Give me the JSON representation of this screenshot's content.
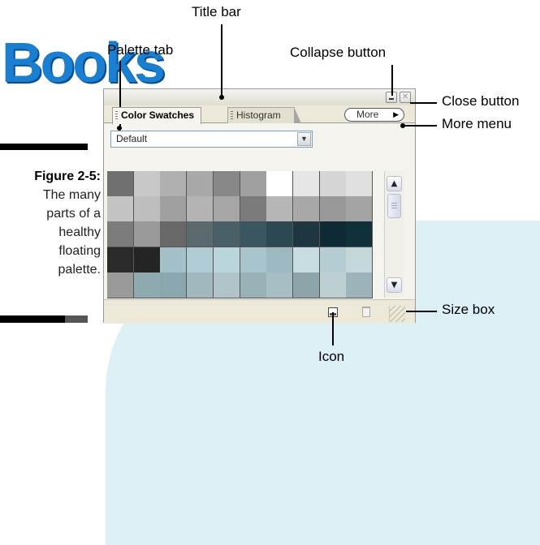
{
  "logo": {
    "text": "Books"
  },
  "figure": {
    "label": "Figure 2-5:",
    "lines": [
      "The many",
      "parts of a",
      "healthy",
      "floating",
      "palette."
    ]
  },
  "callouts": {
    "title_bar": "Title bar",
    "palette_tab": "Palette tab",
    "collapse_button": "Collapse button",
    "close_button": "Close button",
    "more_menu": "More menu",
    "size_box": "Size box",
    "icon": "Icon"
  },
  "palette": {
    "tabs": [
      {
        "label": "Color Swatches",
        "active": true
      },
      {
        "label": "Histogram",
        "active": false
      }
    ],
    "more_button": {
      "label": "More",
      "icon": "triangle-right-icon"
    },
    "swatch_set": {
      "selected": "Default"
    },
    "swatch_rows": [
      [
        "#707070",
        "#c8c8c8",
        "#b0b0b0",
        "#a8a8a8",
        "#888888",
        "#a0a0a0",
        "#ffffff",
        "#e6e6e6",
        "#d6d6d6",
        "#e0e0e0"
      ],
      [
        "#c4c4c4",
        "#bebebe",
        "#a0a0a0",
        "#b4b4b4",
        "#a6a6a6",
        "#7a7a7a",
        "#b6b6b6",
        "#a8a8a8",
        "#999999",
        "#a4a4a4"
      ],
      [
        "#7c7c7c",
        "#9a9a9a",
        "#686868",
        "#5a6a6e",
        "#4a6068",
        "#3a5660",
        "#2c4852",
        "#1e3640",
        "#0e2a34",
        "#10303a"
      ],
      [
        "#2a2a2a",
        "#242424",
        "#a4c0c8",
        "#b0ccd4",
        "#bcd6dd",
        "#a8c4cc",
        "#9cb8c0",
        "#c8dde2",
        "#b4ccd2",
        "#c4d8dc"
      ],
      [
        "#9a9a9a",
        "#90aab2",
        "#8aa6ae",
        "#a0b8be",
        "#b0c4ca",
        "#98b2b8",
        "#a6bec4",
        "#8ca4aa",
        "#bcd0d4",
        "#9cb4ba"
      ]
    ]
  }
}
